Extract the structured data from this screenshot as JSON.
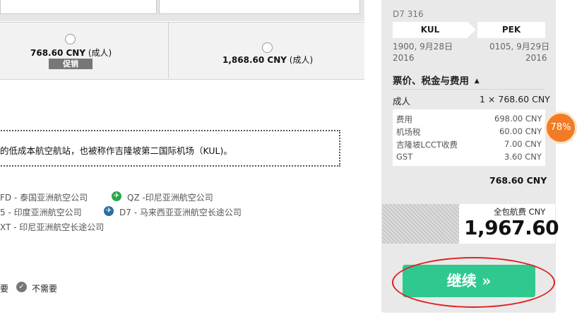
{
  "fares": [
    {
      "price": "768.60 CNY",
      "unit": "(成人)",
      "badge": "促销"
    },
    {
      "price": "1,868.60 CNY",
      "unit": "(成人)"
    }
  ],
  "info_text": "的低成本航空航站，也被称作吉隆坡第二国际机场（KUL)。",
  "airlines": [
    {
      "code": "FD - 泰国亚洲航空公司"
    },
    {
      "code": "QZ -印尼亚洲航空公司",
      "icon_color": "#2aa84a"
    },
    {
      "code": "5 - 印度亚洲航空公司"
    },
    {
      "code": "D7 - 马来西亚亚洲航空长途公司",
      "icon_color": "#2a6fa0"
    },
    {
      "code": "XT - 印尼亚洲航空长途公司"
    }
  ],
  "options": {
    "need_tail": "要",
    "not_need": "不需要"
  },
  "sidebar": {
    "flight_no": "D7 316",
    "origin": "KUL",
    "destination": "PEK",
    "depart_line1": "1900, 9月28日",
    "depart_line2": "2016",
    "arrive_line1": "0105, 9月29日",
    "arrive_line2": "2016",
    "fees_header": "票价、税金与费用",
    "adult_label": "成人",
    "adult_value": "1 × 768.60 CNY",
    "breakdown": [
      {
        "label": "费用",
        "value": "698.00 CNY"
      },
      {
        "label": "机场税",
        "value": "60.00 CNY"
      },
      {
        "label": "吉隆坡LCCT收费",
        "value": "7.00 CNY"
      },
      {
        "label": "GST",
        "value": "3.60 CNY"
      }
    ],
    "subtotal": "768.60 CNY",
    "total_label": "全包航费 CNY",
    "total_value": "1,967.60",
    "continue_label": "继续 »"
  },
  "progress_badge": "78%",
  "colors": {
    "continue": "#2fc98f",
    "badge": "#f07d26",
    "highlight": "#e02020"
  }
}
